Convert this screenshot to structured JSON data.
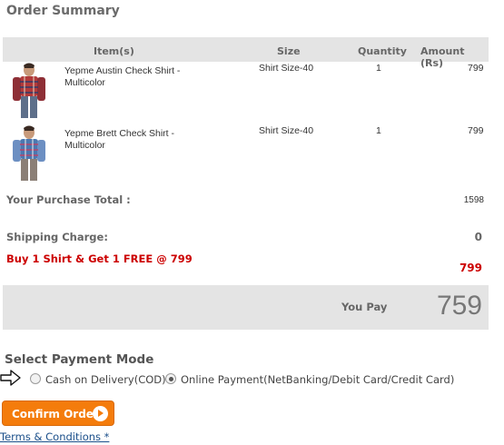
{
  "title": "Order Summary",
  "table": {
    "headers": {
      "item": "Item(s)",
      "size": "Size",
      "quantity": "Quantity",
      "amount": "Amount (Rs)"
    },
    "rows": [
      {
        "name": "Yepme Austin Check Shirt - Multicolor",
        "size": "Shirt Size-40",
        "quantity": "1",
        "amount": "799",
        "image": "shirt-model-red-check"
      },
      {
        "name": "Yepme Brett Check Shirt - Multicolor",
        "size": "Shirt Size-40",
        "quantity": "1",
        "amount": "799",
        "image": "shirt-model-blue-check"
      }
    ]
  },
  "summary": {
    "purchase_total_label": "Your Purchase Total :",
    "purchase_total_value": "1598",
    "shipping_label": "Shipping Charge:",
    "shipping_value": "0",
    "promo_label": "Buy 1 Shirt & Get 1 FREE @ 799",
    "promo_value": "799",
    "you_pay_label": "You Pay",
    "you_pay_value": "759"
  },
  "payment": {
    "title": "Select Payment Mode",
    "options": [
      {
        "label": "Cash on Delivery(COD)",
        "selected": false
      },
      {
        "label": "Online Payment(NetBanking/Debit Card/Credit Card)",
        "selected": true
      }
    ],
    "pointer_icon": "arrow-right-icon"
  },
  "confirm_button": {
    "label": "Confirm Order",
    "icon": "play-circle-icon"
  },
  "terms_link": "Terms & Conditions *",
  "colors": {
    "accent": "#f47c0c",
    "promo": "#cc0000",
    "link": "#1b4f8a",
    "panel": "#e4e4e4"
  }
}
